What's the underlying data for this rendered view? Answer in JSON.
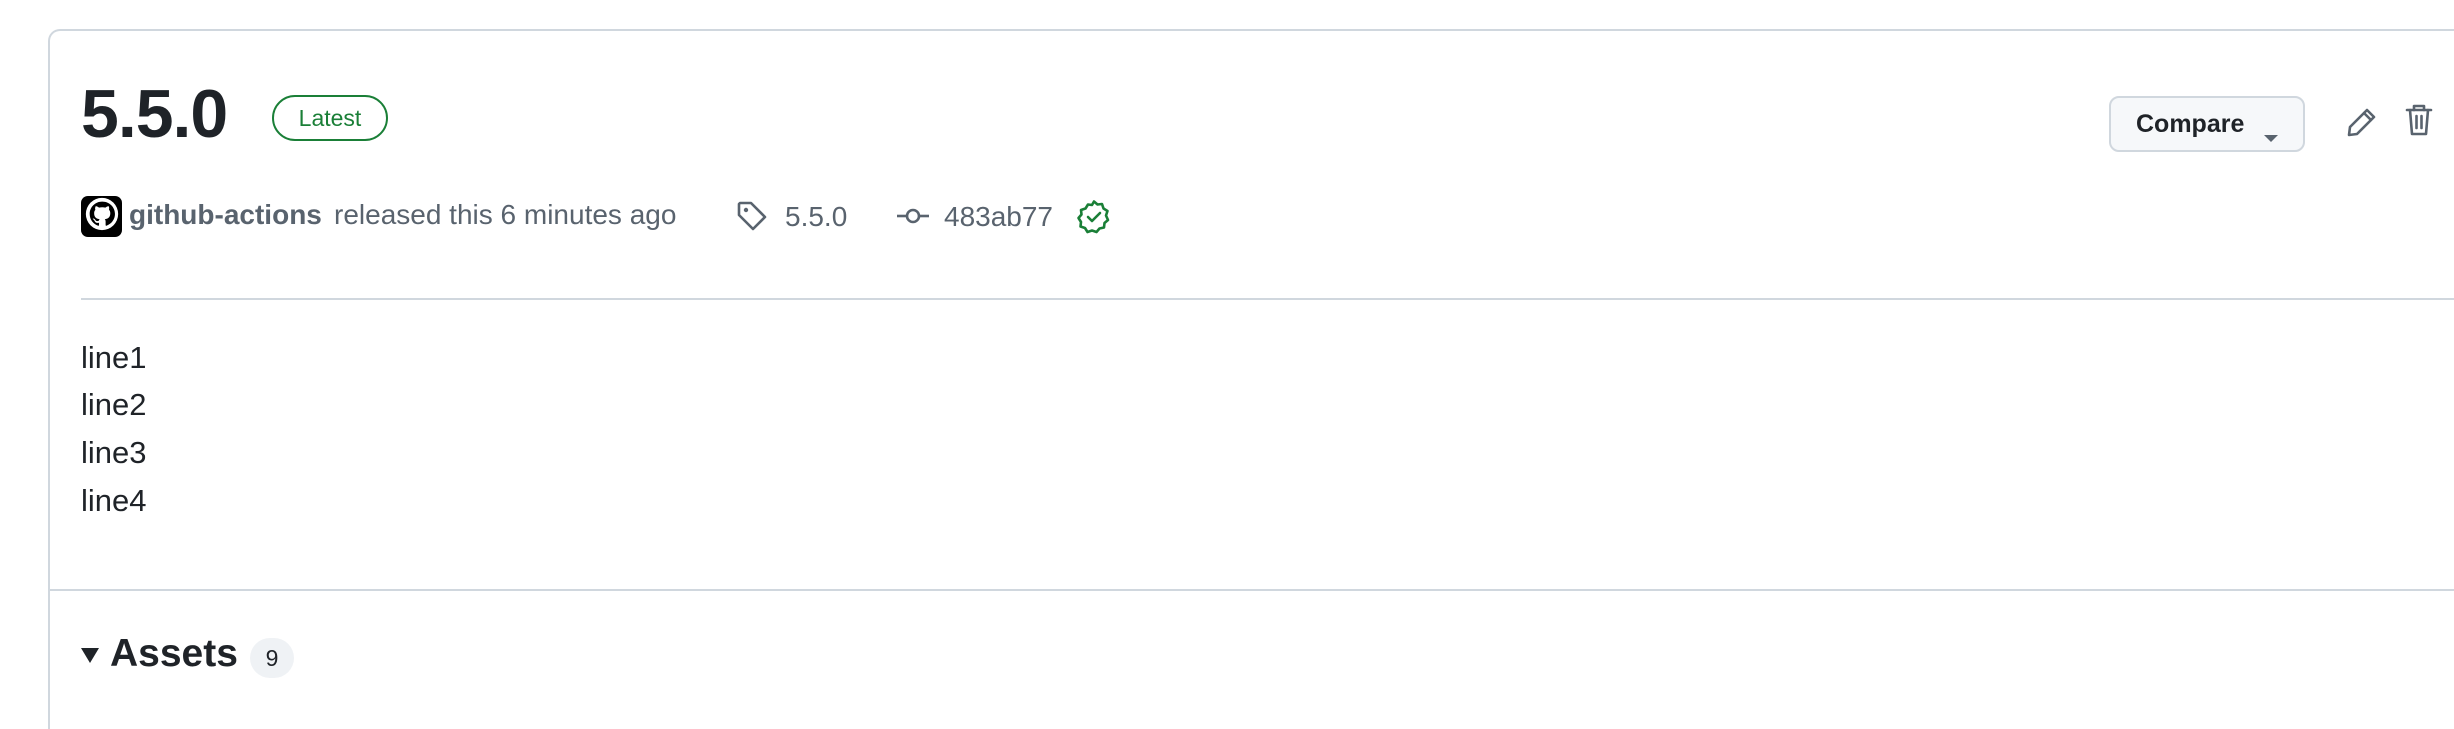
{
  "release": {
    "title": "5.5.0",
    "badge": "Latest",
    "author": "github-actions",
    "released_text": "released this 6 minutes ago",
    "tag": "5.5.0",
    "commit": "483ab77",
    "body_lines": [
      "line1",
      "line2",
      "line3",
      "line4"
    ]
  },
  "toolbar": {
    "compare_label": "Compare",
    "icons": [
      "pencil-icon",
      "trash-icon"
    ]
  },
  "assets": {
    "title": "Assets",
    "count": "9"
  },
  "colors": {
    "accent_green": "#1a7f37",
    "muted_text": "#59636e",
    "border": "#d0d7de"
  }
}
